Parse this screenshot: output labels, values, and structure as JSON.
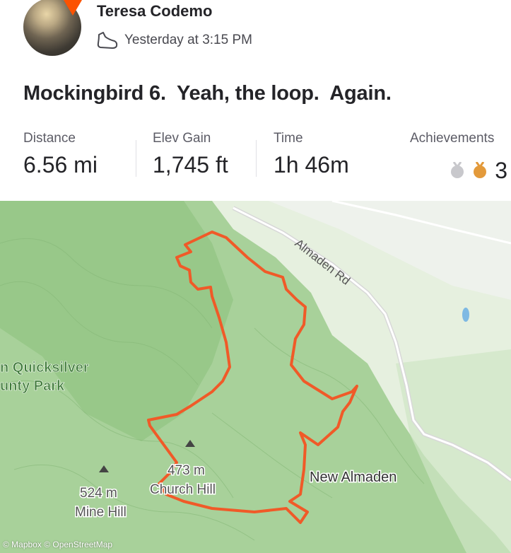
{
  "athlete": {
    "name": "Teresa Codemo"
  },
  "activity": {
    "timestamp": "Yesterday at 3:15 PM",
    "title": "Mockingbird 6.  Yeah, the loop.  Again."
  },
  "stats": {
    "distance": {
      "label": "Distance",
      "value": "6.56 mi"
    },
    "elev_gain": {
      "label": "Elev Gain",
      "value": "1,745 ft"
    },
    "time": {
      "label": "Time",
      "value": "1h 46m"
    },
    "achievements": {
      "label": "Achievements",
      "count": "3"
    }
  },
  "map": {
    "park_label_line1": "n Quicksilver",
    "park_label_line2": "unty Park",
    "road_label": "Almaden Rd",
    "town_label": "New Almaden",
    "peak1_elev": "524 m",
    "peak1_name": "Mine Hill",
    "peak2_elev": "473 m",
    "peak2_name": "Church Hill",
    "attribution": "© Mapbox © OpenStreetMap",
    "route_color": "#f05a28",
    "terrain_color": "#a8d19a"
  },
  "icons": {
    "activity_type": "shoe-icon",
    "medal_silver": "silver-medal-icon",
    "medal_bronze": "bronze-medal-icon"
  }
}
